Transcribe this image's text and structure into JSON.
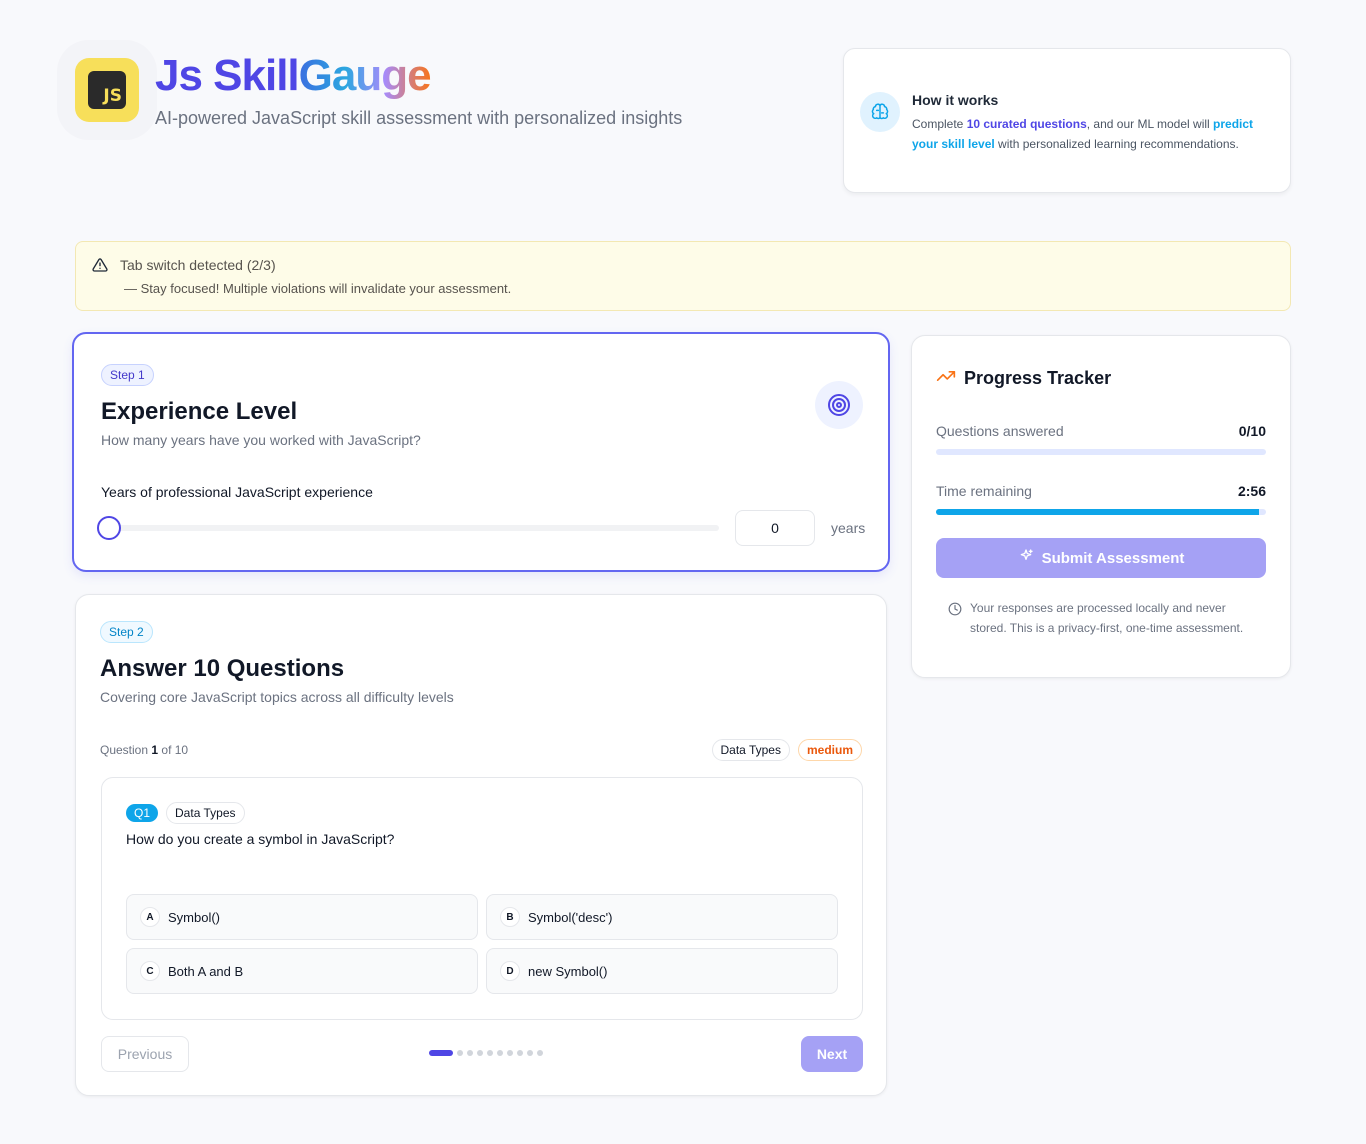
{
  "header": {
    "logo_text": "JS",
    "title_part1": "Js Skill",
    "title_part2": "Gauge",
    "subtitle": "AI-powered JavaScript skill assessment with personalized insights"
  },
  "how_it_works": {
    "title": "How it works",
    "text_1": "Complete ",
    "highlight_1": "10 curated questions",
    "text_2": ", and our ML model will ",
    "highlight_2": "predict your skill level",
    "text_3": " with personalized learning recommendations."
  },
  "warning": {
    "title": "Tab switch detected (2/3)",
    "message": "— Stay focused! Multiple violations will invalidate your assessment."
  },
  "step1": {
    "badge": "Step 1",
    "title": "Experience Level",
    "description": "How many years have you worked with JavaScript?",
    "slider_label": "Years of professional JavaScript experience",
    "years_value": "0",
    "unit": "years",
    "slider_fraction": 0
  },
  "step2": {
    "badge": "Step 2",
    "title": "Answer 10 Questions",
    "description": "Covering core JavaScript topics across all difficulty levels",
    "question_prefix": "Question ",
    "question_current": "1",
    "question_suffix": " of 10",
    "topic_tag": "Data Types",
    "difficulty_tag": "medium",
    "question": {
      "number": "Q1",
      "topic": "Data Types",
      "text": "How do you create a symbol in JavaScript?",
      "options": [
        {
          "letter": "A",
          "text": "Symbol()"
        },
        {
          "letter": "B",
          "text": "Symbol('desc')"
        },
        {
          "letter": "C",
          "text": "Both A and B"
        },
        {
          "letter": "D",
          "text": "new Symbol()"
        }
      ]
    },
    "previous_label": "Previous",
    "next_label": "Next",
    "total_questions": 10,
    "active_index": 0
  },
  "progress": {
    "title": "Progress Tracker",
    "answered_label": "Questions answered",
    "answered_value": "0/10",
    "answered_fraction": 0,
    "time_label": "Time remaining",
    "time_value": "2:56",
    "time_fraction": 0.98,
    "submit_label": "Submit Assessment",
    "privacy_text": "Your responses are processed locally and never stored. This is a privacy-first, one-time assessment."
  },
  "colors": {
    "accent": "#4f46e5",
    "sky": "#0ea5e9",
    "warning_bg": "#fefce8",
    "difficulty": "#ea580c"
  }
}
